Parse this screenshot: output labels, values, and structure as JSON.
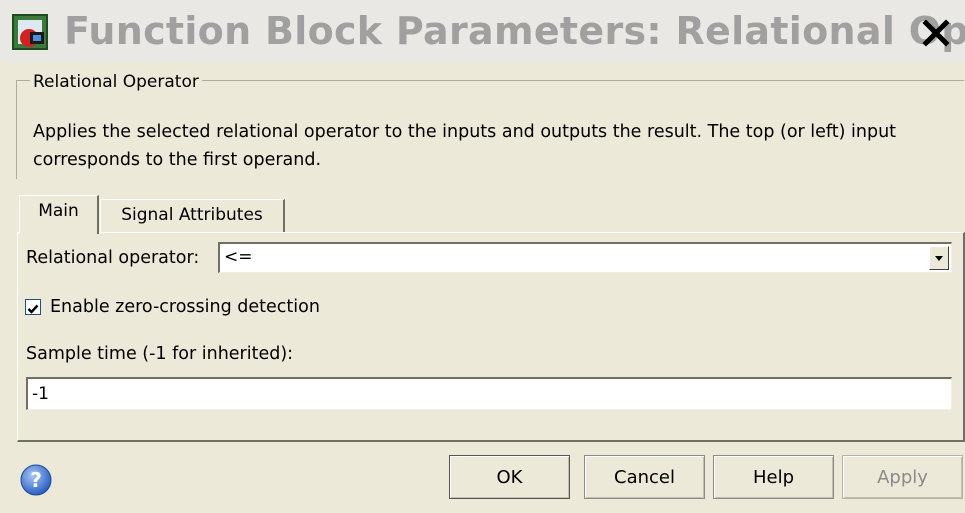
{
  "window": {
    "title": "Function Block Parameters: Relational Op...",
    "close_label": "✕"
  },
  "group": {
    "title": "Relational Operator",
    "description_line1": "Applies the selected relational operator to the inputs and outputs the result. The top (or left) input",
    "description_line2": "corresponds to the first operand."
  },
  "tabs": [
    {
      "label": "Main",
      "active": true
    },
    {
      "label": "Signal Attributes",
      "active": false
    }
  ],
  "main": {
    "operator_label": "Relational operator:",
    "operator_value": "<=",
    "zero_crossing_label": "Enable zero-crossing detection",
    "zero_crossing_checked": true,
    "sample_time_label": "Sample time (-1 for inherited):",
    "sample_time_value": "-1"
  },
  "buttons": {
    "ok": "OK",
    "cancel": "Cancel",
    "help": "Help",
    "apply": "Apply"
  },
  "colors": {
    "background": "#ece9d8",
    "title_text": "#a0a0a0",
    "help_icon": "#3a6fd0"
  },
  "icons": {
    "window_icon": "simulink-block-icon",
    "help": "help-question-icon",
    "dropdown": "chevron-down-icon",
    "check": "checkmark-icon"
  }
}
